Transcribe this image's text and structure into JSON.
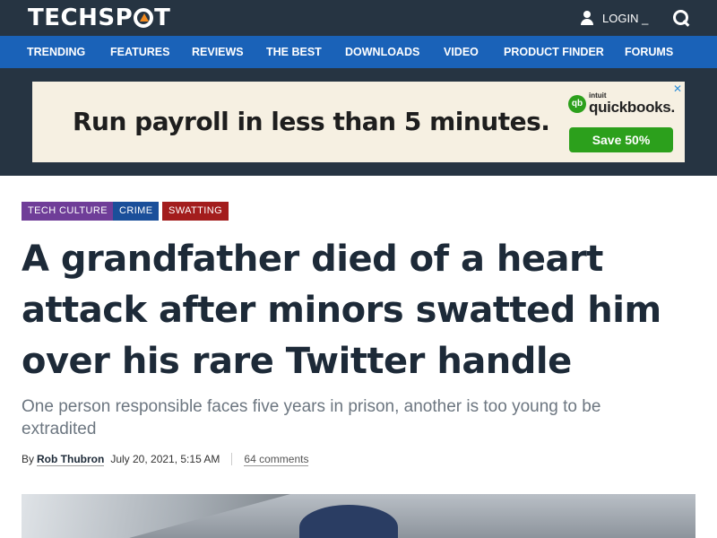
{
  "header": {
    "logo_text_1": "TECHSP",
    "logo_text_2": "T",
    "login_label": "LOGIN _"
  },
  "nav": {
    "items": [
      "TRENDING",
      "FEATURES",
      "REVIEWS",
      "THE BEST",
      "DOWNLOADS",
      "VIDEO",
      "PRODUCT FINDER",
      "FORUMS"
    ]
  },
  "ad": {
    "headline": "Run payroll in less than 5 minutes.",
    "brand_small": "intuit",
    "brand_name": "quickbooks.",
    "cta": "Save 50%",
    "close": "✕"
  },
  "article": {
    "tags": [
      {
        "label": "TECH CULTURE",
        "color": "#6f3d98"
      },
      {
        "label": "CRIME",
        "color": "#1a4f9a"
      },
      {
        "label": "SWATTING",
        "color": "#a31d1d"
      }
    ],
    "title": "A grandfather died of a heart attack after minors swatted him over his rare Twitter handle",
    "subtitle": "One person responsible faces five years in prison, another is too young to be extradited",
    "by_label": "By",
    "author": "Rob Thubron",
    "date": "July 20, 2021, 5:15 AM",
    "comments": "64 comments"
  },
  "colors": {
    "topbar": "#263442",
    "navbar": "#1a62b8",
    "accent_orange": "#f28a1e",
    "qb_green": "#2ca01c"
  }
}
